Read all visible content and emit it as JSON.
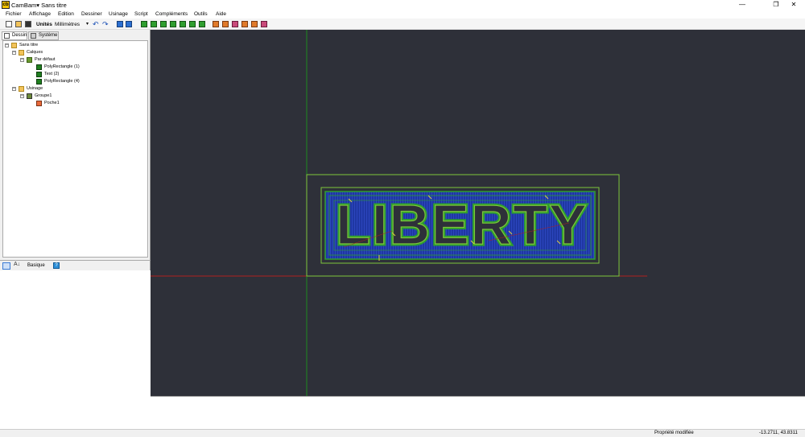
{
  "app": {
    "name": "CamBam",
    "title": "CamBam▾   Sans titre"
  },
  "window_controls": [
    "—",
    "❐",
    "✕"
  ],
  "menu": [
    "Fichier",
    "Affichage",
    "Edition",
    "Dessiner",
    "Usinage",
    "Script",
    "Compléments",
    "Outils",
    "Aide"
  ],
  "toolbar": {
    "units_label": "Unités",
    "units_value": "Millimètres"
  },
  "left_tabs": [
    "Dessin",
    "Système"
  ],
  "tree": {
    "root": "Sans titre",
    "calques": "Calques",
    "par_defaut": "Par défaut",
    "shape1": "PolyRectangle (1)",
    "shape2": "Text (2)",
    "shape3": "PolyRectangle (4)",
    "usinage": "Usinage",
    "group": "Groupe1",
    "poche": "Poche1"
  },
  "properties": {
    "mode": "Basique"
  },
  "canvas": {
    "text": "LIBERTY",
    "colors": {
      "background": "#2e3039",
      "outline": "#7dc63a",
      "toolpath_fill": "#1f37a3",
      "toolpath_line": "#2e9e2e",
      "axis_x": "#b02020",
      "axis_y": "#1f8a1f"
    }
  },
  "status": {
    "message": "Propriété modifiée",
    "coords": "-13.2711, 43.8311"
  }
}
